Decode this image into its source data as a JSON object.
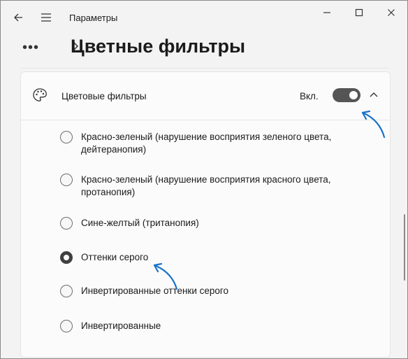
{
  "window": {
    "app_title": "Параметры"
  },
  "breadcrumb": {
    "more": "•••",
    "page_title": "Цветные фильтры"
  },
  "card": {
    "label": "Цветовые фильтры",
    "toggle_label": "Вкл.",
    "toggle_on": true
  },
  "options": [
    {
      "label": "Красно-зеленый (нарушение восприятия зеленого цвета,",
      "label2": "дейтеранопия)",
      "checked": false
    },
    {
      "label": "Красно-зеленый (нарушение восприятия красного цвета,",
      "label2": "протанопия)",
      "checked": false
    },
    {
      "label": "Сине-желтый (тританопия)",
      "label2": "",
      "checked": false
    },
    {
      "label": "Оттенки серого",
      "label2": "",
      "checked": true
    },
    {
      "label": "Инвертированные оттенки серого",
      "label2": "",
      "checked": false
    },
    {
      "label": "Инвертированные",
      "label2": "",
      "checked": false
    }
  ],
  "colors": {
    "annotation_arrow": "#1a73c8",
    "toggle_track": "#555555"
  }
}
